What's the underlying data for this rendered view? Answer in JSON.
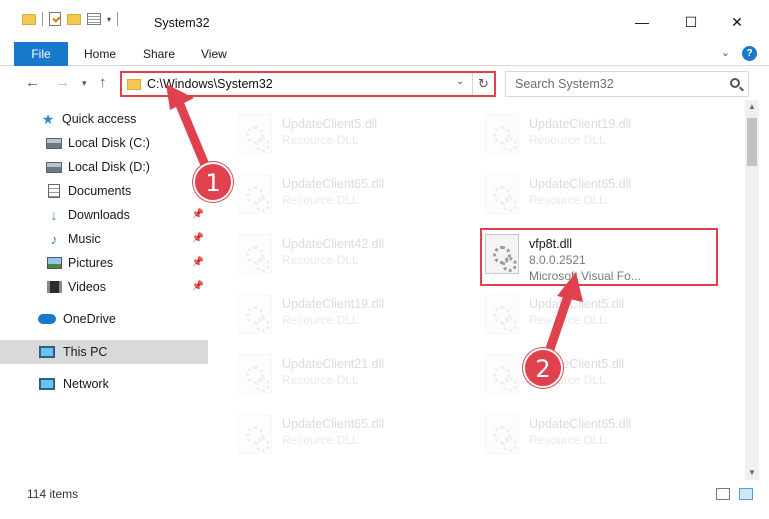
{
  "window": {
    "title": "System32",
    "minimize": "—",
    "maximize": "☐",
    "close": "✕"
  },
  "ribbon": {
    "tabs": [
      "File",
      "Home",
      "Share",
      "View"
    ]
  },
  "address": {
    "path": "C:\\Windows\\System32",
    "search_placeholder": "Search System32"
  },
  "sidebar": {
    "items": [
      {
        "label": "Quick access",
        "icon": "star-icon"
      },
      {
        "label": "Local Disk (C:)",
        "icon": "disk-icon"
      },
      {
        "label": "Local Disk (D:)",
        "icon": "disk-icon"
      },
      {
        "label": "Documents",
        "icon": "documents-icon"
      },
      {
        "label": "Downloads",
        "icon": "download-icon"
      },
      {
        "label": "Music",
        "icon": "music-icon"
      },
      {
        "label": "Pictures",
        "icon": "pictures-icon"
      },
      {
        "label": "Videos",
        "icon": "videos-icon"
      },
      {
        "label": "OneDrive",
        "icon": "cloud-icon"
      },
      {
        "label": "This PC",
        "icon": "computer-icon"
      },
      {
        "label": "Network",
        "icon": "network-icon"
      }
    ]
  },
  "files": {
    "left": [
      {
        "name": "UpdateClient5.dll",
        "type": "Resource DLL"
      },
      {
        "name": "UpdateClient65.dll",
        "type": "Resource DLL"
      },
      {
        "name": "UpdateClient42.dll",
        "type": "Resource DLL"
      },
      {
        "name": "UpdateClient19.dll",
        "type": "Resource DLL"
      },
      {
        "name": "UpdateClient21.dll",
        "type": "Resource DLL"
      },
      {
        "name": "UpdateClient65.dll",
        "type": "Resource DLL"
      }
    ],
    "right": [
      {
        "name": "UpdateClient19.dll",
        "type": "Resource DLL"
      },
      {
        "name": "UpdateClient65.dll",
        "type": "Resource DLL"
      },
      {
        "name": "UpdateClient5.dll",
        "type": "Resource DLL"
      },
      {
        "name": "UpdateClient5.dll",
        "type": "Resource DLL"
      },
      {
        "name": "UpdateClient65.dll",
        "type": "Resource DLL"
      }
    ],
    "highlighted": {
      "name": "vfp8t.dll",
      "version": "8.0.0.2521",
      "description": "Microsoft Visual Fo..."
    }
  },
  "status": {
    "item_count": "114 items"
  },
  "annotations": {
    "badge1": "1",
    "badge2": "2",
    "color": "#e0424d"
  }
}
